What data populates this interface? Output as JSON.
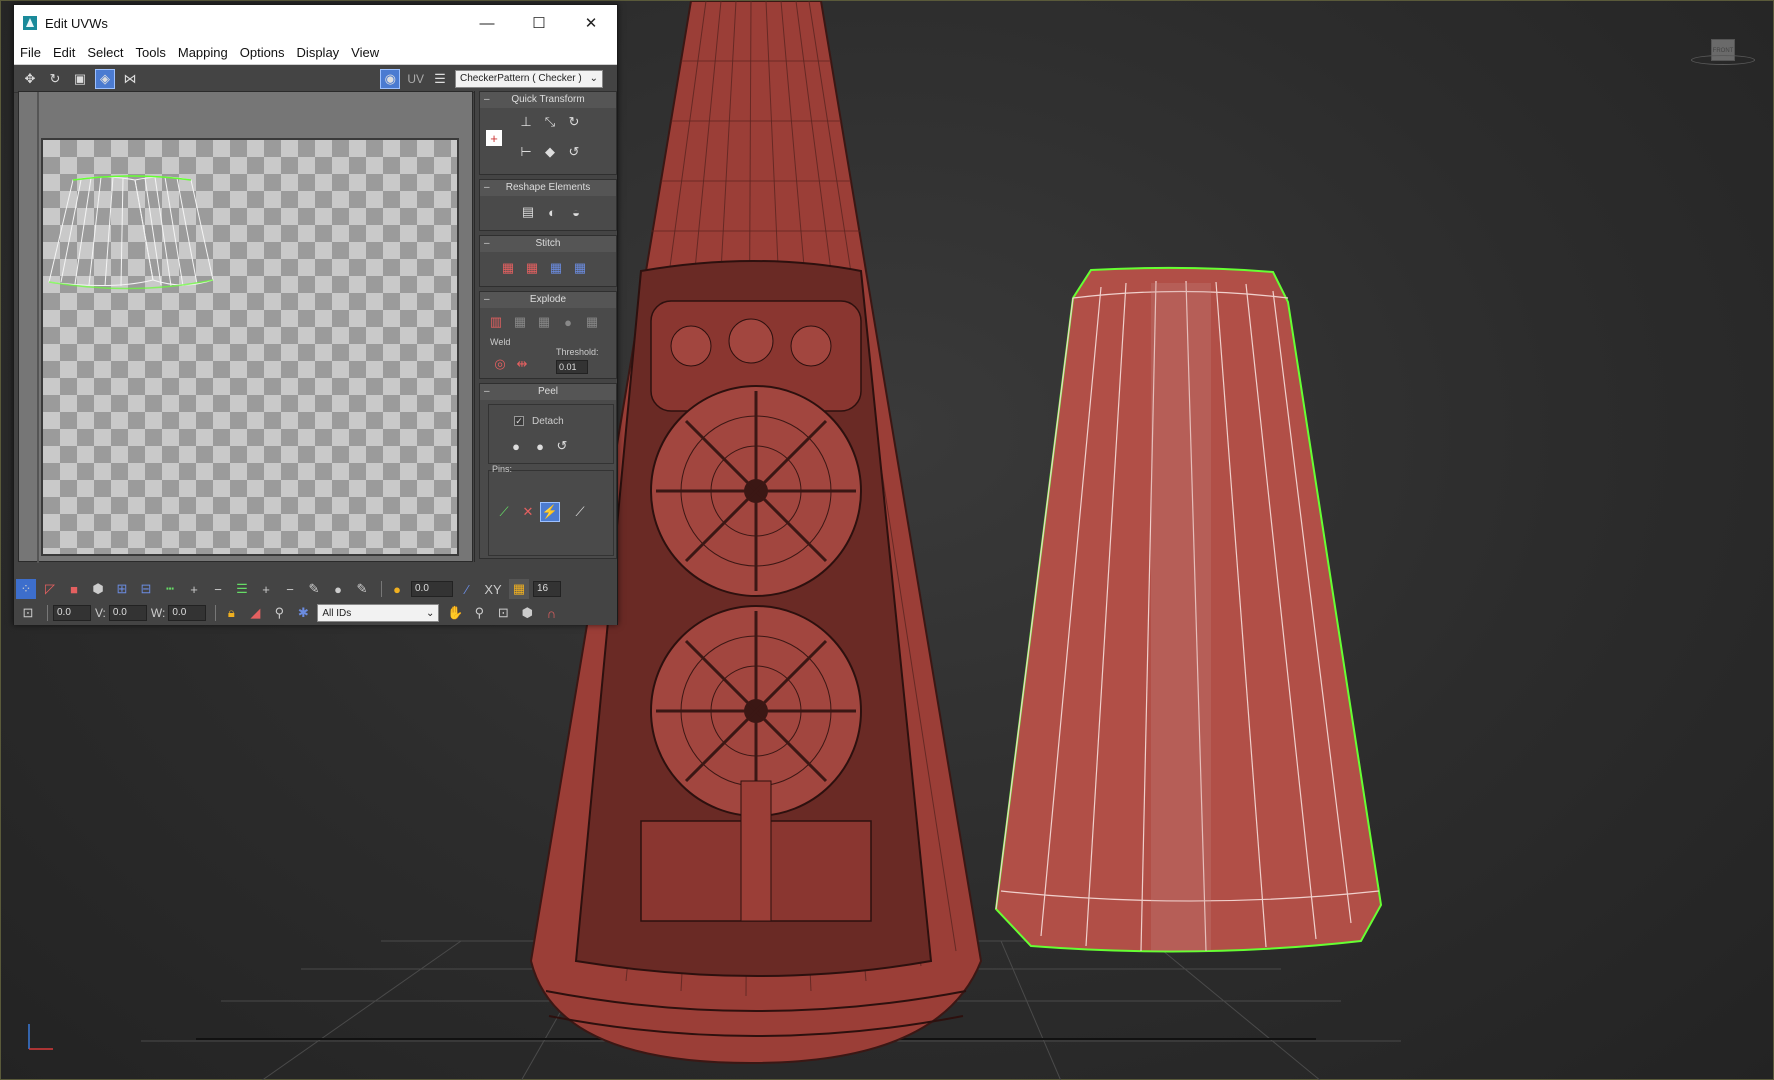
{
  "window": {
    "title": "Edit UVWs",
    "minimize": "—",
    "maximize": "☐",
    "close": "✕"
  },
  "menu": [
    "File",
    "Edit",
    "Select",
    "Tools",
    "Mapping",
    "Options",
    "Display",
    "View"
  ],
  "toolbar": {
    "uv_label": "UV",
    "texture_select": "CheckerPattern  ( Checker )"
  },
  "rollouts": {
    "quick_transform": "Quick Transform",
    "reshape_elements": "Reshape Elements",
    "stitch": "Stitch",
    "explode": "Explode",
    "weld": "Weld",
    "threshold_label": "Threshold:",
    "threshold_value": "0.01",
    "peel": "Peel",
    "detach": "Detach",
    "pins": "Pins:"
  },
  "bottom": {
    "angle_value": "0.0",
    "xy_label": "XY",
    "divisions_value": "16",
    "u_value": "0.0",
    "v_label": "V:",
    "v_value": "0.0",
    "w_label": "W:",
    "w_value": "0.0",
    "id_select": "All IDs"
  },
  "viewcube": {
    "face_label": "FRONT"
  },
  "colors": {
    "selection_edge": "#66ff33",
    "mesh_red": "#a5443c",
    "active_blue": "#4b7bd1"
  },
  "icons": {
    "move": "move-icon",
    "rotate": "rotate-icon",
    "scale": "scale-icon",
    "freeform": "freeform-icon",
    "mirror": "mirror-icon",
    "uv_map": "uv-map-icon",
    "lock": "lock-icon",
    "hand": "pan-icon",
    "zoom": "zoom-icon",
    "magnet": "magnet-icon"
  }
}
